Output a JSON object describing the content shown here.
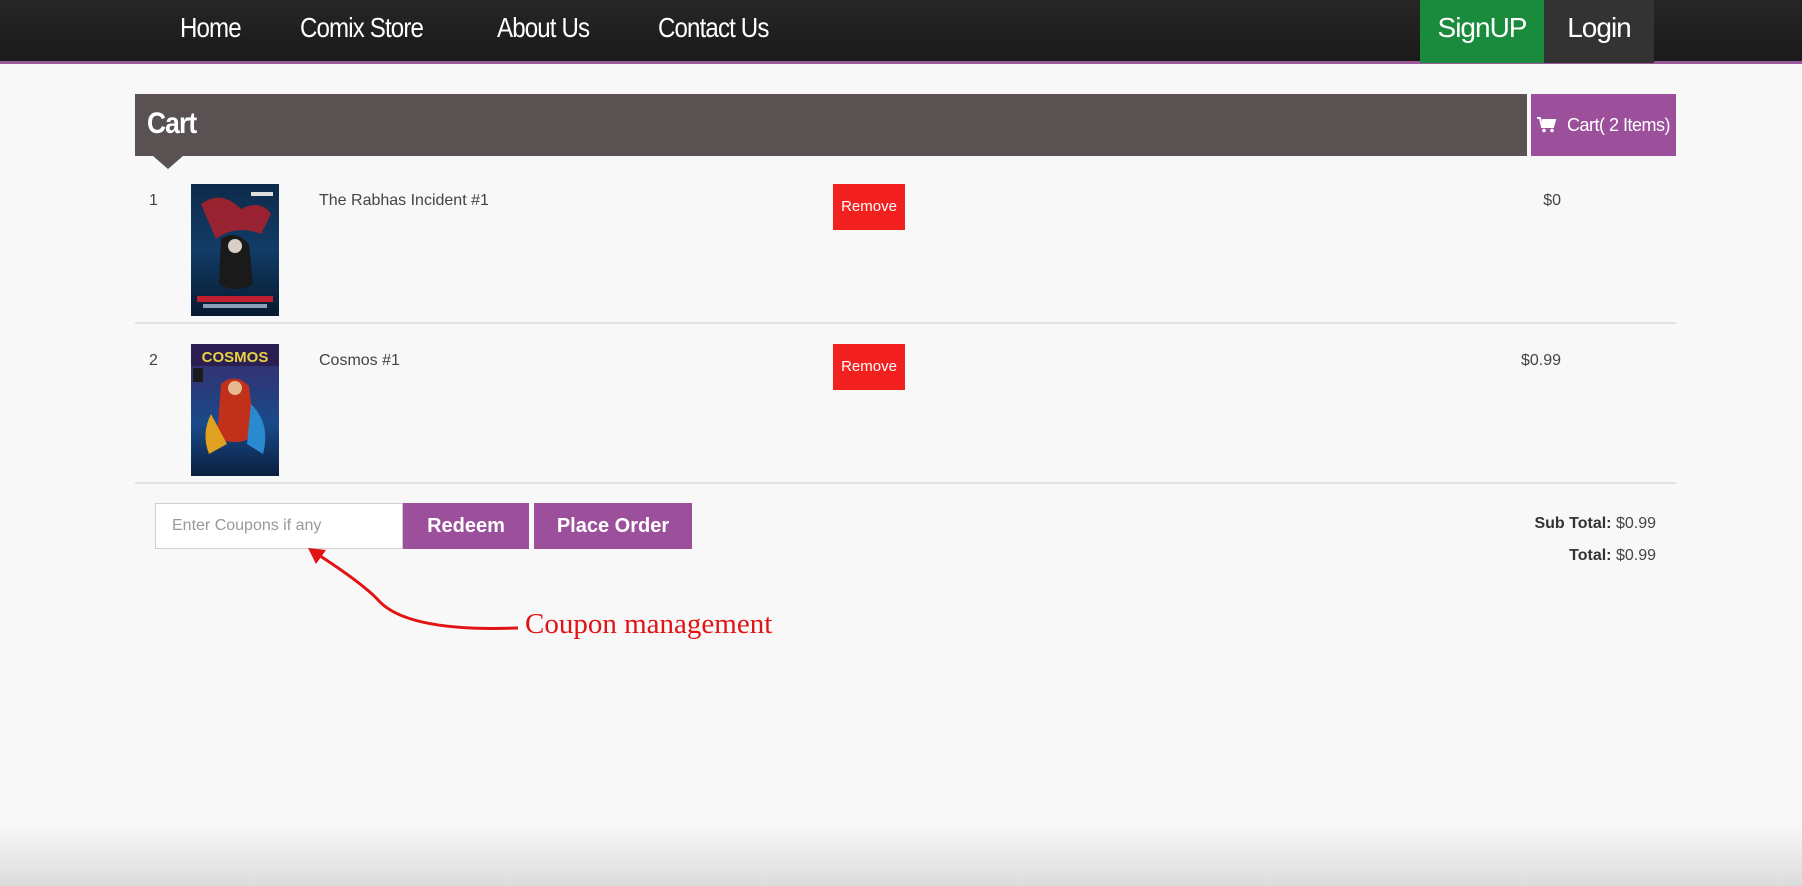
{
  "nav": {
    "links": [
      "Home",
      "Comix Store",
      "About Us",
      "Contact Us"
    ],
    "signup": "SignUP",
    "login": "Login"
  },
  "cart": {
    "title": "Cart",
    "count_label": "Cart( 2 Items)",
    "items": [
      {
        "index": "1",
        "name": "The Rabhas Incident #1",
        "remove": "Remove",
        "price": "$0"
      },
      {
        "index": "2",
        "name": "Cosmos #1",
        "remove": "Remove",
        "price": "$0.99"
      }
    ]
  },
  "coupon": {
    "placeholder": "Enter Coupons if any",
    "redeem": "Redeem",
    "place_order": "Place Order"
  },
  "totals": {
    "sub_label": "Sub Total:",
    "sub_value": "$0.99",
    "total_label": "Total:",
    "total_value": "$0.99"
  },
  "annotation": "Coupon management",
  "colors": {
    "accent": "#9c4f9a",
    "signup": "#1a8a3c",
    "remove": "#f2201e",
    "annotation": "#e01414"
  }
}
